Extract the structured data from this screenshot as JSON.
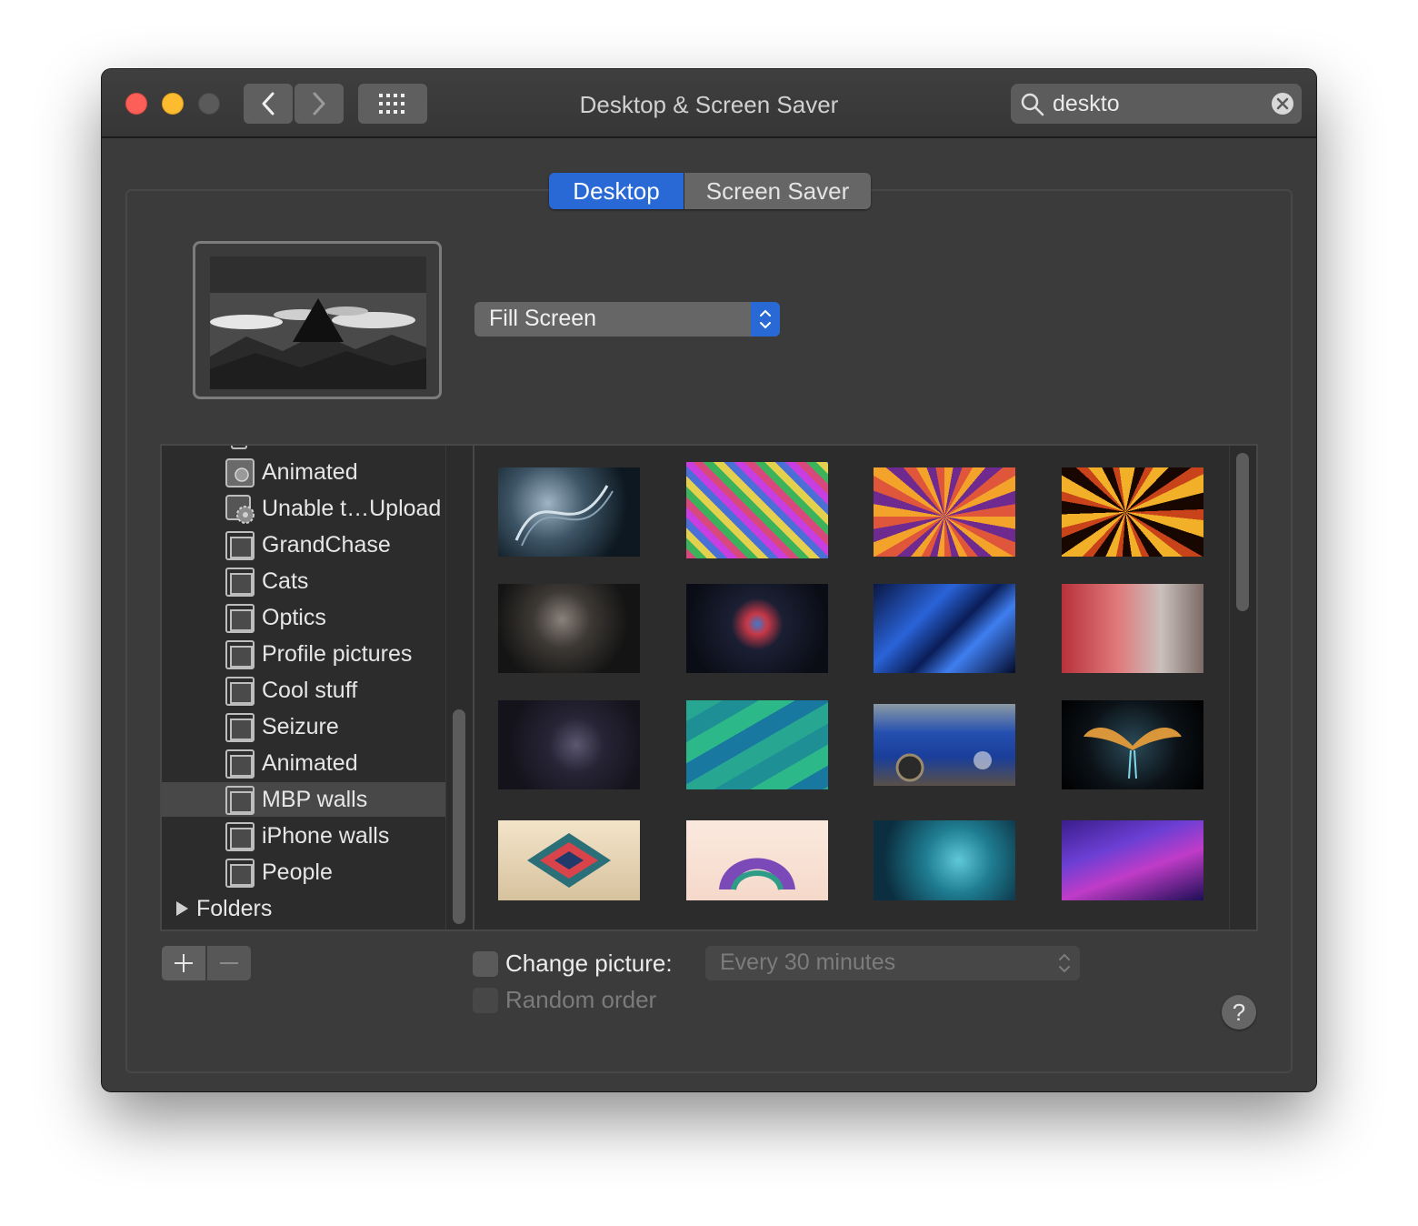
{
  "window": {
    "title": "Desktop & Screen Saver"
  },
  "search": {
    "value": "deskto"
  },
  "tabs": [
    {
      "label": "Desktop",
      "selected": true
    },
    {
      "label": "Screen Saver",
      "selected": false
    }
  ],
  "scaling": {
    "selected": "Fill Screen"
  },
  "sidebar": {
    "items": [
      {
        "label": "Animated",
        "icon": "album-icon"
      },
      {
        "label": "Unable t…Upload",
        "icon": "smart-album-gear-icon"
      },
      {
        "label": "GrandChase",
        "icon": "album-icon"
      },
      {
        "label": "Cats",
        "icon": "album-icon"
      },
      {
        "label": "Optics",
        "icon": "album-icon"
      },
      {
        "label": "Profile pictures",
        "icon": "album-icon"
      },
      {
        "label": "Cool stuff",
        "icon": "album-icon"
      },
      {
        "label": "Seizure",
        "icon": "album-icon"
      },
      {
        "label": "Animated",
        "icon": "album-icon"
      },
      {
        "label": "MBP walls",
        "icon": "album-icon",
        "selected": true
      },
      {
        "label": "iPhone walls",
        "icon": "album-icon"
      },
      {
        "label": "People",
        "icon": "album-icon"
      }
    ],
    "folders_label": "Folders"
  },
  "wallpapers": [
    {
      "name": "dna-helix-dark"
    },
    {
      "name": "neon-grid-colorful"
    },
    {
      "name": "fractal-orange-purple"
    },
    {
      "name": "fractal-black-gold"
    },
    {
      "name": "woman-portrait-dark"
    },
    {
      "name": "crystal-star-dark"
    },
    {
      "name": "blue-abstract-shards"
    },
    {
      "name": "helmet-woman-red"
    },
    {
      "name": "figure-dark-purple"
    },
    {
      "name": "teal-polygon-pattern"
    },
    {
      "name": "blue-sports-car"
    },
    {
      "name": "golden-wings"
    },
    {
      "name": "geometric-diamond"
    },
    {
      "name": "polygon-arch"
    },
    {
      "name": "dna-teal"
    },
    {
      "name": "purple-nebula"
    }
  ],
  "bottom": {
    "change_picture_label": "Change picture:",
    "interval": "Every 30 minutes",
    "random_order_label": "Random order",
    "help_label": "?",
    "change_picture_checked": false,
    "random_order_checked": false
  },
  "colors": {
    "accent": "#2869d6",
    "window_bg": "#3b3b3b",
    "close": "#fc5f57",
    "minimize": "#fdbc2f"
  }
}
